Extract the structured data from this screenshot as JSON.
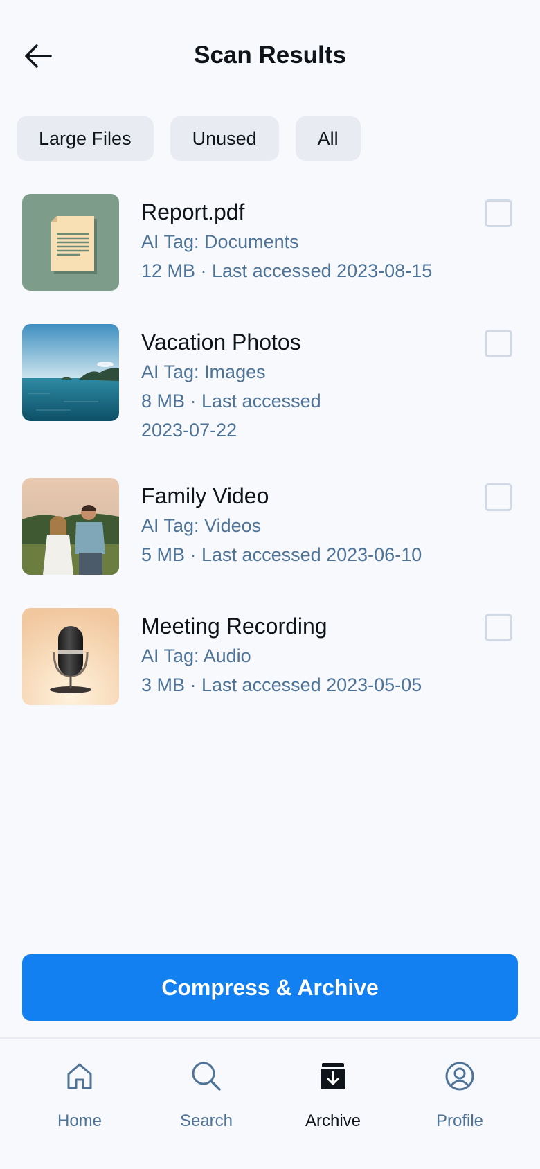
{
  "header": {
    "title": "Scan Results"
  },
  "filters": [
    {
      "label": "Large Files"
    },
    {
      "label": "Unused"
    },
    {
      "label": "All"
    }
  ],
  "files": [
    {
      "name": "Report.pdf",
      "tag": "AI Tag: Documents",
      "meta": "12 MB · Last accessed 2023-08-15",
      "thumb": "document-thumbnail"
    },
    {
      "name": "Vacation Photos",
      "tag": "AI Tag: Images",
      "meta": "8 MB · Last accessed 2023-07-22",
      "thumb": "sea-photo-thumbnail"
    },
    {
      "name": "Family Video",
      "tag": "AI Tag: Videos",
      "meta": "5 MB · Last accessed 2023-06-10",
      "thumb": "couple-photo-thumbnail"
    },
    {
      "name": "Meeting Recording",
      "tag": "AI Tag: Audio",
      "meta": "3 MB · Last accessed 2023-05-05",
      "thumb": "microphone-thumbnail"
    }
  ],
  "action": {
    "label": "Compress & Archive"
  },
  "nav": [
    {
      "label": "Home",
      "icon": "home-icon"
    },
    {
      "label": "Search",
      "icon": "search-icon"
    },
    {
      "label": "Archive",
      "icon": "archive-icon",
      "active": true
    },
    {
      "label": "Profile",
      "icon": "profile-icon"
    }
  ],
  "colors": {
    "accent": "#1280f0",
    "muted_text": "#4f7396",
    "chip_bg": "#e8ecf2",
    "background": "#f7f9fc"
  }
}
